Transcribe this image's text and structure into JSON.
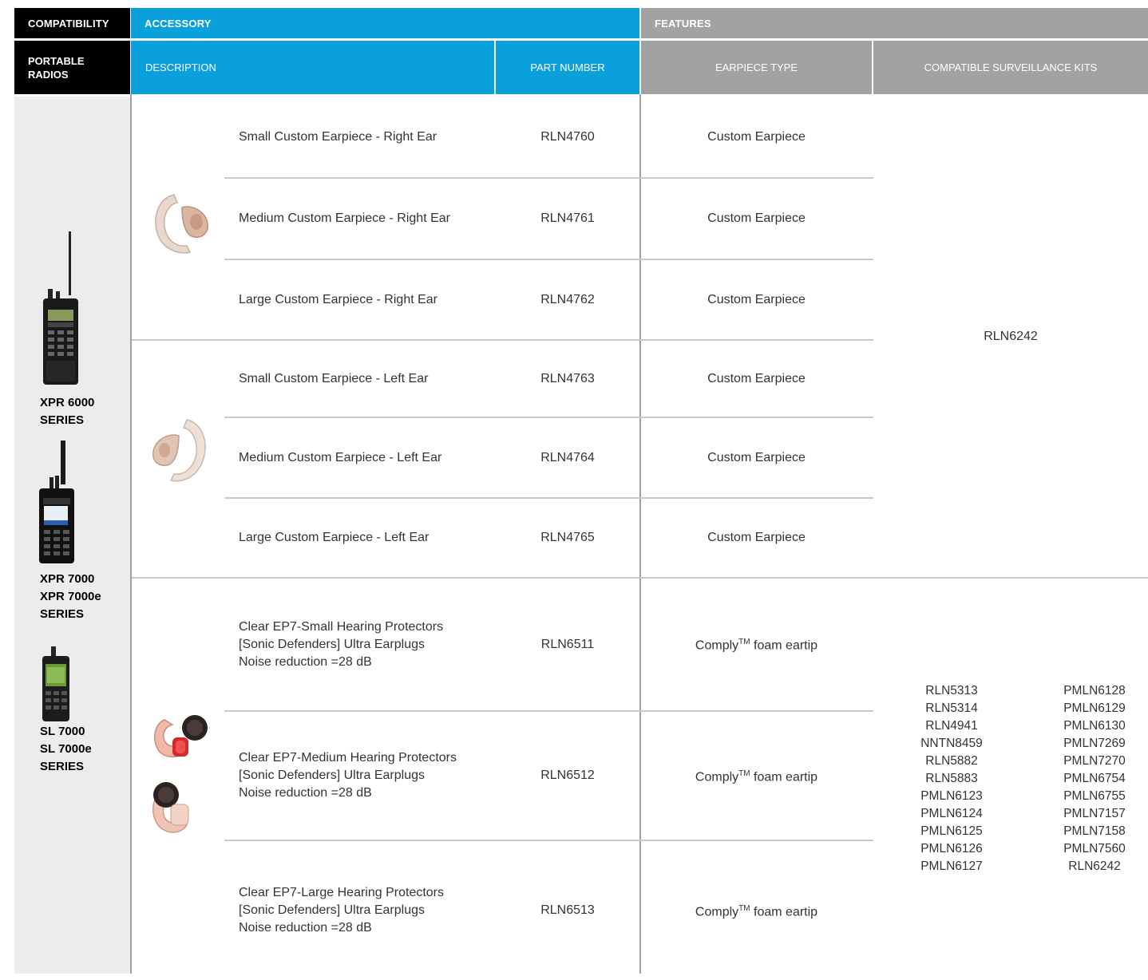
{
  "header": {
    "compatibility": "COMPATIBILITY",
    "accessory": "ACCESSORY",
    "features": "FEATURES",
    "portable_radios": "PORTABLE\nRADIOS",
    "description": "DESCRIPTION",
    "part_number": "PART NUMBER",
    "earpiece_type": "EARPIECE TYPE",
    "compatible_kits": "COMPATIBLE SURVEILLANCE KITS"
  },
  "radios": [
    {
      "label": "XPR 6000\nSERIES"
    },
    {
      "label": "XPR 7000\nXPR 7000e\nSERIES"
    },
    {
      "label": "SL 7000\nSL 7000e\nSERIES"
    }
  ],
  "rows": [
    {
      "description": "Small Custom Earpiece - Right Ear",
      "part": "RLN4760",
      "type": "Custom Earpiece"
    },
    {
      "description": "Medium Custom Earpiece - Right Ear",
      "part": "RLN4761",
      "type": "Custom Earpiece"
    },
    {
      "description": "Large Custom Earpiece - Right Ear",
      "part": "RLN4762",
      "type": "Custom Earpiece"
    },
    {
      "description": "Small Custom Earpiece - Left Ear",
      "part": "RLN4763",
      "type": "Custom Earpiece"
    },
    {
      "description": "Medium Custom Earpiece - Left Ear",
      "part": "RLN4764",
      "type": "Custom Earpiece"
    },
    {
      "description": "Large Custom Earpiece - Left Ear",
      "part": "RLN4765",
      "type": "Custom Earpiece"
    },
    {
      "description": "Clear EP7-Small Hearing Protectors\n[Sonic Defenders] Ultra Earplugs\nNoise reduction =28 dB",
      "part": "RLN6511",
      "type_main": "Comply",
      "type_sup": "TM",
      "type_rest": " foam eartip"
    },
    {
      "description": "Clear EP7-Medium Hearing Protectors\n[Sonic Defenders] Ultra Earplugs\nNoise reduction =28 dB",
      "part": "RLN6512",
      "type_main": "Comply",
      "type_sup": "TM",
      "type_rest": " foam eartip"
    },
    {
      "description": "Clear EP7-Large Hearing Protectors\n[Sonic Defenders] Ultra Earplugs\nNoise reduction =28 dB",
      "part": "RLN6513",
      "type_main": "Comply",
      "type_sup": "TM",
      "type_rest": " foam eartip"
    }
  ],
  "kits_custom": "RLN6242",
  "kits_comply_left": "RLN5313\nRLN5314\nRLN4941\nNNTN8459\nRLN5882\nRLN5883\nPMLN6123\nPMLN6124\nPMLN6125\nPMLN6126\nPMLN6127",
  "kits_comply_right": "PMLN6128\nPMLN6129\nPMLN6130\nPMLN7269\nPMLN7270\nPMLN6754\nPMLN6755\nPMLN7157\nPMLN7158\nPMLN7560\nRLN6242",
  "colors": {
    "black": "#000000",
    "blue": "#0aa0dc",
    "grey": "#a2a2a2",
    "compat_bg": "#ececec"
  }
}
